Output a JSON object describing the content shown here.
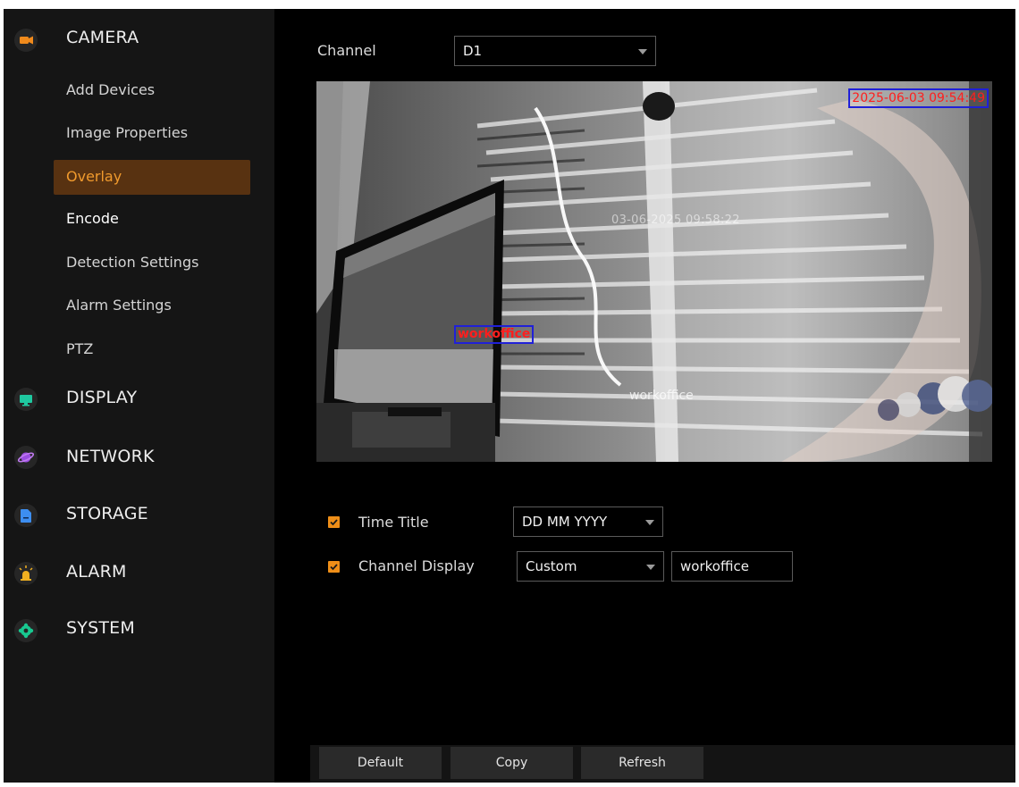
{
  "sidebar": {
    "categories": [
      {
        "label": "CAMERA",
        "icon": "camera-icon",
        "color": "#f08a1c"
      },
      {
        "label": "DISPLAY",
        "icon": "monitor-icon",
        "color": "#1fc8a0"
      },
      {
        "label": "NETWORK",
        "icon": "globe-icon",
        "color": "#9b4de0"
      },
      {
        "label": "STORAGE",
        "icon": "storage-icon",
        "color": "#3d8ef0"
      },
      {
        "label": "ALARM",
        "icon": "alarm-icon",
        "color": "#f0b020"
      },
      {
        "label": "SYSTEM",
        "icon": "gear-icon",
        "color": "#18c890"
      }
    ],
    "camera_items": [
      {
        "label": "Add Devices"
      },
      {
        "label": "Image Properties"
      },
      {
        "label": "Overlay",
        "active": true
      },
      {
        "label": "Encode"
      },
      {
        "label": "Detection Settings"
      },
      {
        "label": "Alarm Settings"
      },
      {
        "label": "PTZ"
      }
    ]
  },
  "main": {
    "channel": {
      "label": "Channel",
      "value": "D1"
    },
    "preview": {
      "time_overlay": "2025-06-03 09:54:49",
      "channel_overlay": "workoffice",
      "camera_time_text": "03-06-2025 09:58:22",
      "camera_channel_text": "workoffice"
    },
    "time_title": {
      "label": "Time Title",
      "checked": true,
      "format": "DD MM YYYY"
    },
    "channel_display": {
      "label": "Channel Display",
      "checked": true,
      "mode": "Custom",
      "text": "workoffice"
    },
    "buttons": {
      "default": "Default",
      "copy": "Copy",
      "refresh": "Refresh"
    }
  },
  "colors": {
    "accent": "#ee8e18",
    "active_bg": "#583211",
    "overlay_red": "#ff1e1e",
    "overlay_box": "#2020d8"
  }
}
